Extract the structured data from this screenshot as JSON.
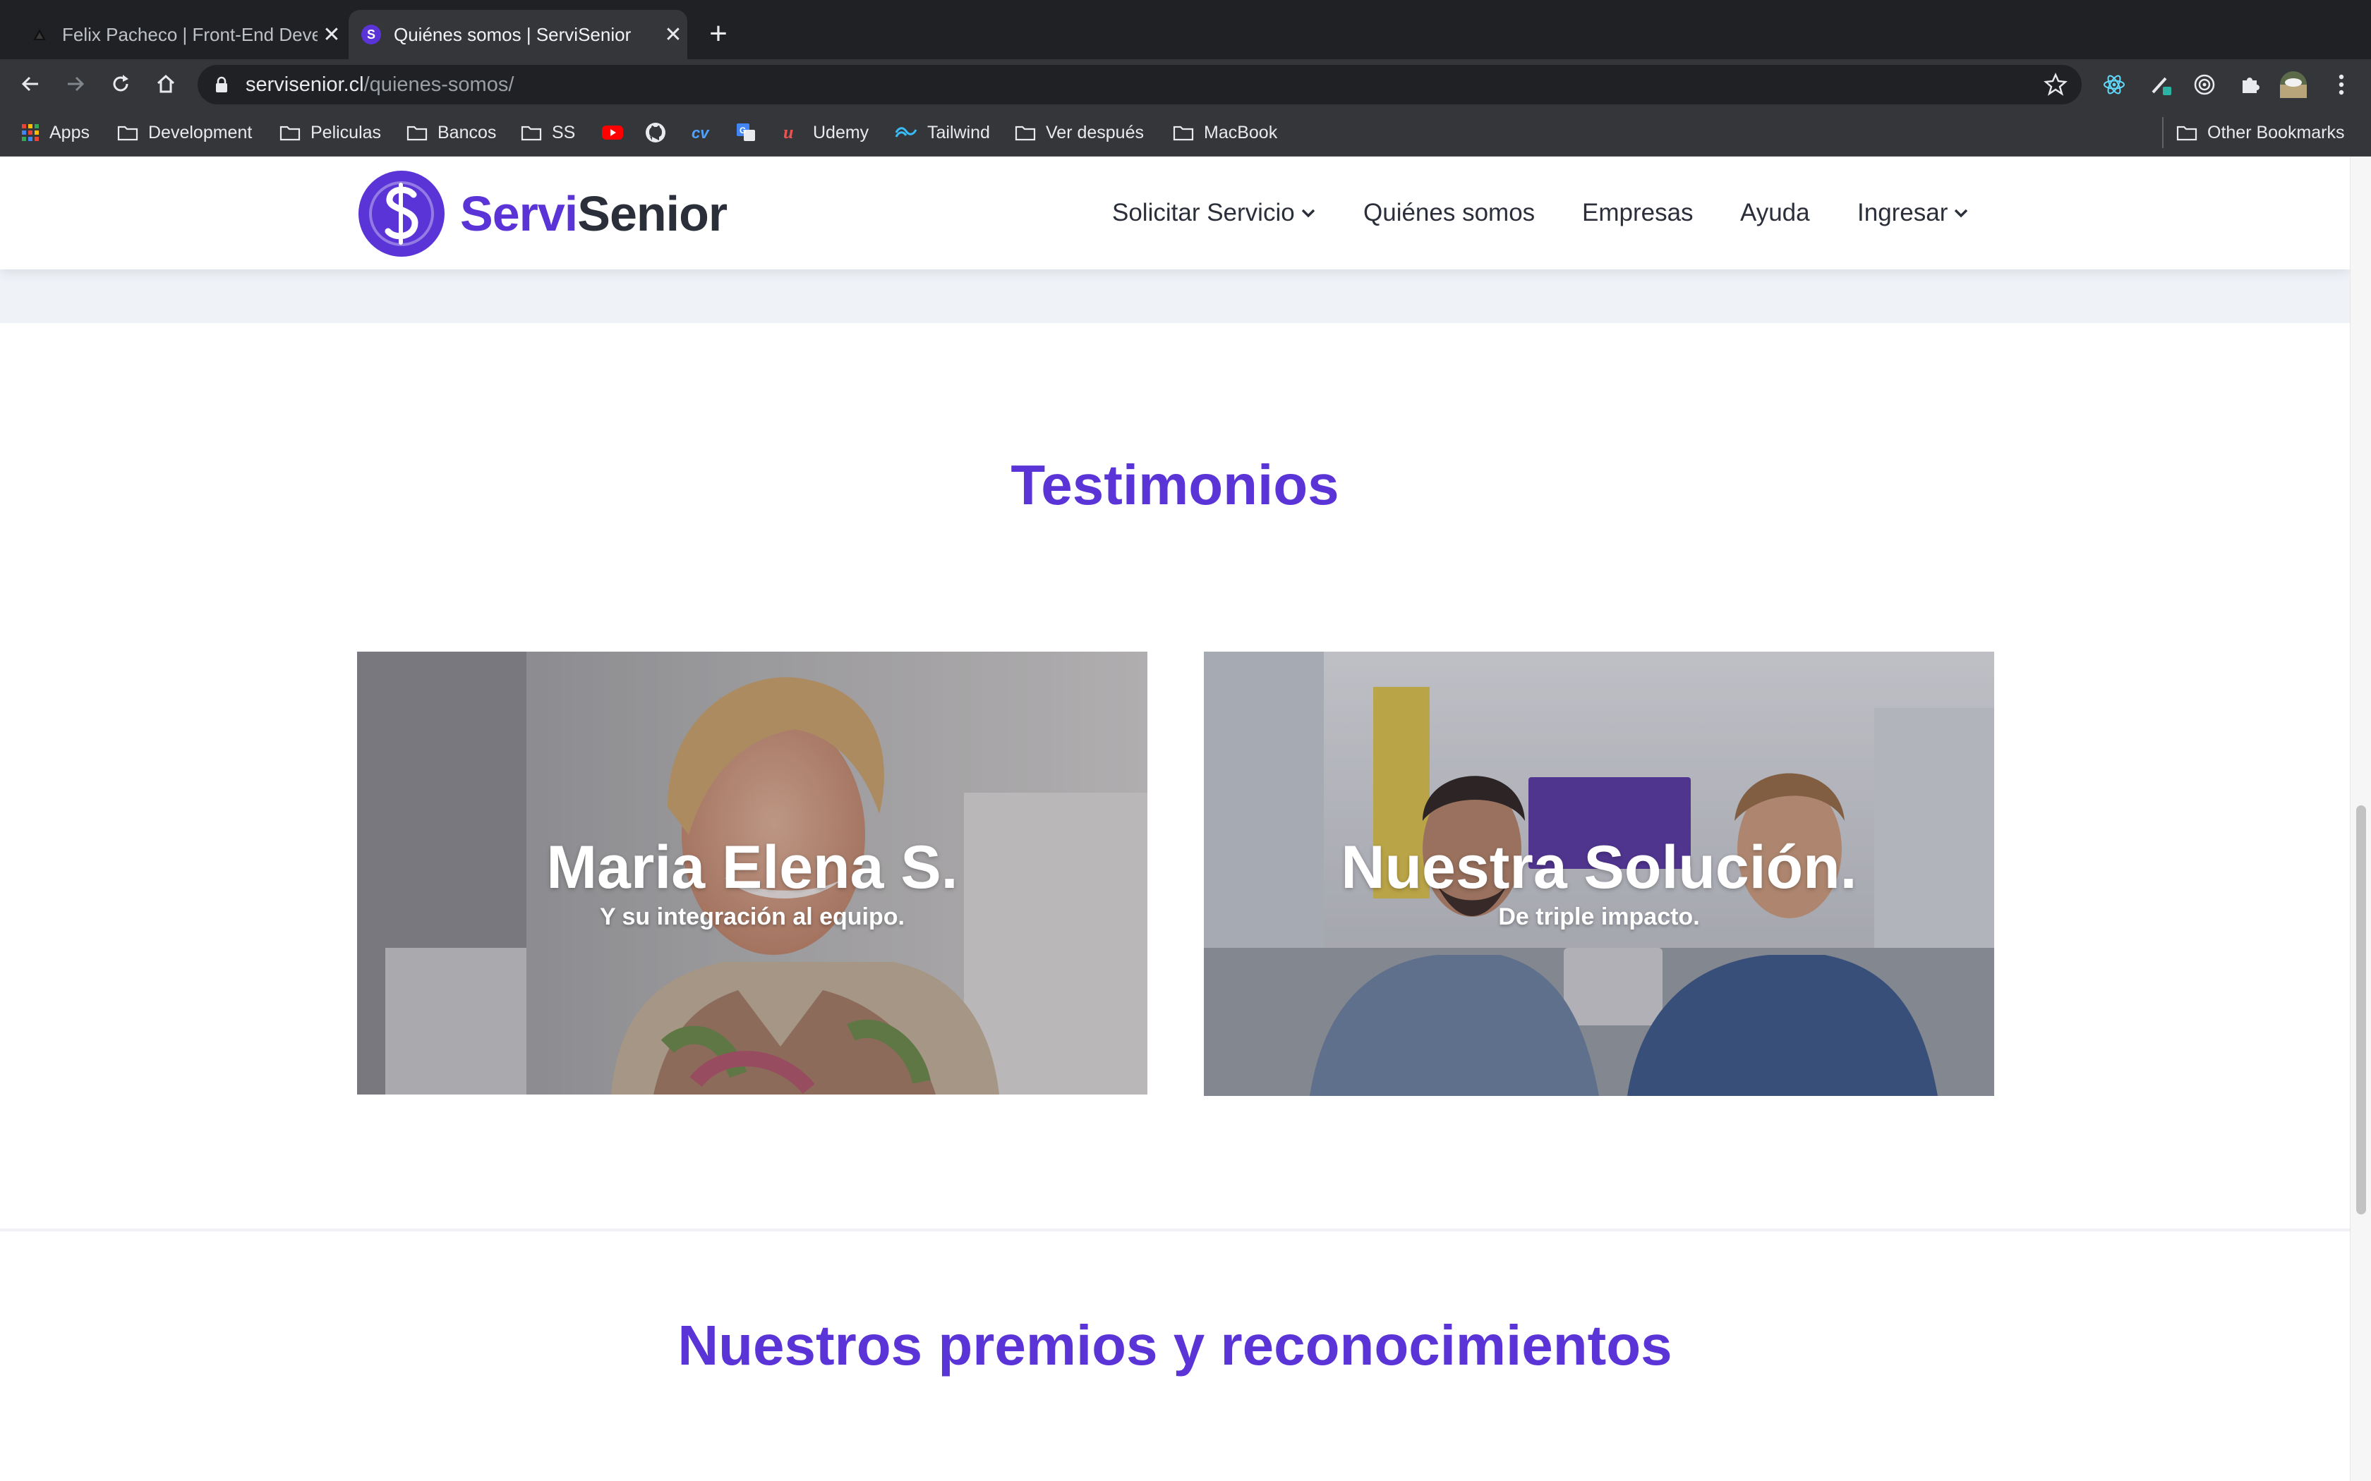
{
  "browser": {
    "tabs": [
      {
        "title": "Felix Pacheco | Front-End Deve",
        "active": false,
        "favicon": "triangle-icon"
      },
      {
        "title": "Quiénes somos | ServiSenior",
        "active": true,
        "favicon": "servisenior-logo-icon"
      }
    ],
    "close_glyph": "✕",
    "new_tab_glyph": "+",
    "url_host": "servisenior.cl",
    "url_path": "/quienes-somos/",
    "bookmarks": [
      {
        "label": "Apps",
        "icon": "apps-grid-icon"
      },
      {
        "label": "Development",
        "icon": "folder-icon"
      },
      {
        "label": "Peliculas",
        "icon": "folder-icon"
      },
      {
        "label": "Bancos",
        "icon": "folder-icon"
      },
      {
        "label": "SS",
        "icon": "folder-icon"
      },
      {
        "label": "",
        "icon": "youtube-icon"
      },
      {
        "label": "",
        "icon": "github-icon"
      },
      {
        "label": "",
        "icon": "cv-icon"
      },
      {
        "label": "",
        "icon": "translate-icon"
      },
      {
        "label": "Udemy",
        "icon": "udemy-icon"
      },
      {
        "label": "Tailwind",
        "icon": "tailwind-icon"
      },
      {
        "label": "Ver después",
        "icon": "folder-icon"
      },
      {
        "label": "MacBook",
        "icon": "folder-icon"
      }
    ],
    "other_bookmarks": "Other Bookmarks"
  },
  "site": {
    "brand": {
      "part1": "Servi",
      "part2": "Senior"
    },
    "nav": {
      "solicitar": "Solicitar Servicio",
      "quienes": "Quiénes somos",
      "empresas": "Empresas",
      "ayuda": "Ayuda",
      "ingresar": "Ingresar"
    },
    "testimonials_title": "Testimonios",
    "cards": [
      {
        "title": "Maria Elena S.",
        "subtitle": "Y su integración al equipo."
      },
      {
        "title": "Nuestra Solución.",
        "subtitle": "De triple impacto."
      }
    ],
    "awards_title": "Nuestros premios y reconocimientos"
  },
  "colors": {
    "brand_purple": "#5a34d6",
    "text_dark": "#2b2f3a",
    "chrome_dark": "#202124"
  }
}
